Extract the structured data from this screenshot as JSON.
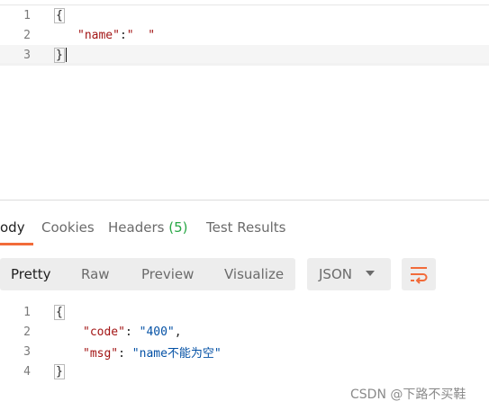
{
  "request": {
    "lines": [
      {
        "number": "1",
        "text": "{"
      },
      {
        "number": "2",
        "key": "\"name\"",
        "sep": ":",
        "value": "\"  \""
      },
      {
        "number": "3",
        "text": "}"
      }
    ]
  },
  "response_tabs": [
    {
      "label": "ody",
      "active": true
    },
    {
      "label": "Cookies",
      "active": false
    },
    {
      "label": "Headers",
      "badge": "(5)",
      "active": false
    },
    {
      "label": "Test Results",
      "active": false
    }
  ],
  "view_modes": [
    {
      "label": "Pretty",
      "active": true
    },
    {
      "label": "Raw",
      "active": false
    },
    {
      "label": "Preview",
      "active": false
    },
    {
      "label": "Visualize",
      "active": false
    }
  ],
  "format_select": {
    "value": "JSON"
  },
  "icons": {
    "wrap": "wrap-lines-icon",
    "dropdown": "chevron-down-icon"
  },
  "colors": {
    "accent": "#f26b3a",
    "badge_green": "#28a745",
    "json_key": "#a31515",
    "json_string": "#0451a5"
  },
  "response": {
    "lines": [
      {
        "number": "1",
        "text": "{"
      },
      {
        "number": "2",
        "key": "\"code\"",
        "sep": ": ",
        "value": "\"400\"",
        "trail": ","
      },
      {
        "number": "3",
        "key": "\"msg\"",
        "sep": ": ",
        "value": "\"name不能为空\""
      },
      {
        "number": "4",
        "text": "}"
      }
    ]
  },
  "watermark": "CSDN @下路不买鞋"
}
